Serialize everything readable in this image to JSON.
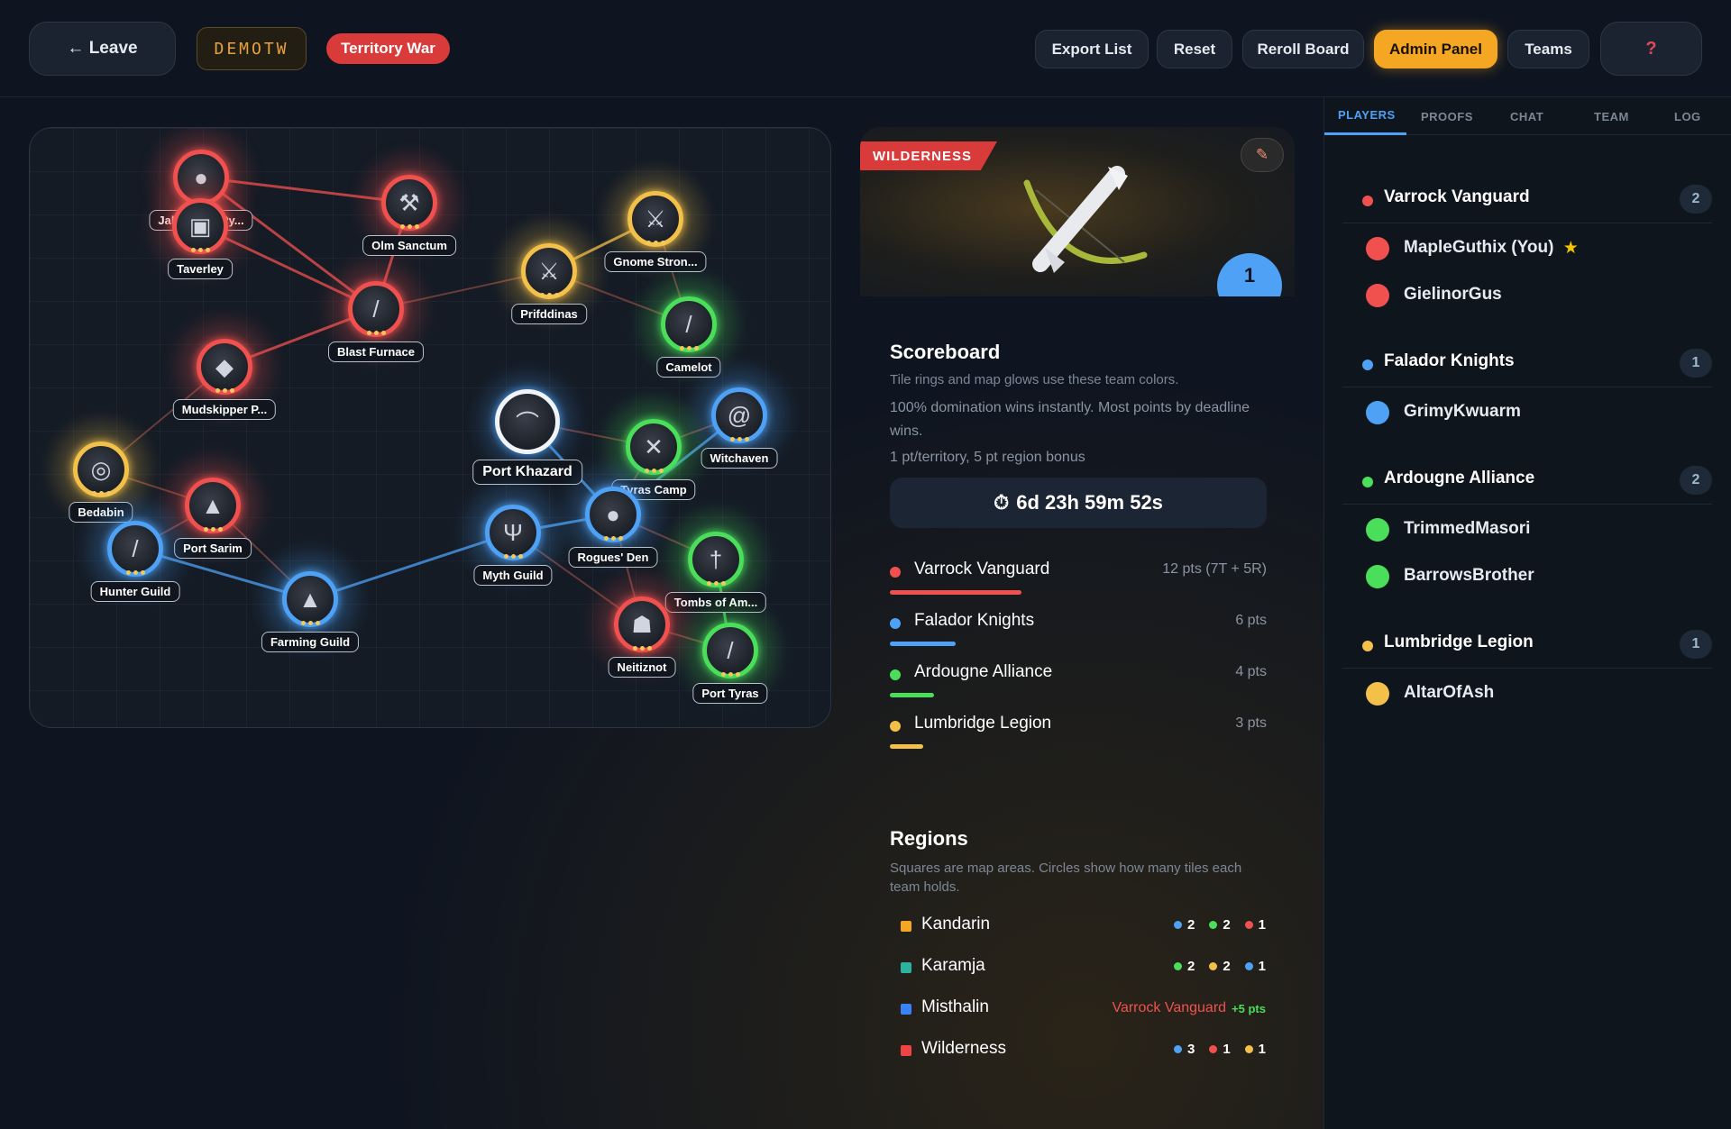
{
  "topbar": {
    "leave": "← Leave",
    "room_code": "DEMOTW",
    "mode": "Territory War",
    "buttons": {
      "export": "Export List",
      "reset": "Reset",
      "reroll": "Reroll Board",
      "admin": "Admin Panel",
      "teams": "Teams",
      "help": "?"
    }
  },
  "colors": {
    "red": "#f0514f",
    "blue": "#4ea1f4",
    "green": "#4ade5a",
    "yellow": "#f3c04a",
    "accent": "#f5a623"
  },
  "map": {
    "nodes": [
      {
        "label": "Jaldraocht Py...",
        "team": "red",
        "icon": "amulet-icon"
      },
      {
        "label": "Olm Sanctum",
        "team": "red",
        "icon": "hammer-icon"
      },
      {
        "label": "Gnome Stron...",
        "team": "yellow",
        "icon": "axe-icon"
      },
      {
        "label": "Taverley",
        "team": "red",
        "icon": "armour-icon"
      },
      {
        "label": "Prifddinas",
        "team": "yellow",
        "icon": "sword-icon"
      },
      {
        "label": "Blast Furnace",
        "team": "red",
        "icon": "staff-icon"
      },
      {
        "label": "Camelot",
        "team": "green",
        "icon": "spear-icon"
      },
      {
        "label": "Mudskipper P...",
        "team": "red",
        "icon": "crystal-icon"
      },
      {
        "label": "Port Khazard",
        "team": "blue",
        "icon": "bow-icon",
        "selected": true
      },
      {
        "label": "Witchaven",
        "team": "blue",
        "icon": "whip-icon"
      },
      {
        "label": "Tyras Camp",
        "team": "green",
        "icon": "crossbow-icon"
      },
      {
        "label": "Bedabin",
        "team": "yellow",
        "icon": "ring-icon"
      },
      {
        "label": "Port Sarim",
        "team": "red",
        "icon": "helm-icon"
      },
      {
        "label": "Rogues' Den",
        "team": "blue",
        "icon": "orb-icon"
      },
      {
        "label": "Myth Guild",
        "team": "blue",
        "icon": "claws-icon"
      },
      {
        "label": "Hunter Guild",
        "team": "blue",
        "icon": "wand-icon"
      },
      {
        "label": "Tombs of Am...",
        "team": "green",
        "icon": "dagger-icon"
      },
      {
        "label": "Farming Guild",
        "team": "blue",
        "icon": "hat-icon"
      },
      {
        "label": "Neitiznot",
        "team": "red",
        "icon": "mask-icon"
      },
      {
        "label": "Port Tyras",
        "team": "green",
        "icon": "blade-icon"
      }
    ]
  },
  "tile": {
    "region_tag": "WILDERNESS",
    "drops": "1",
    "icon": "crossbow-icon"
  },
  "scoreboard": {
    "title": "Scoreboard",
    "note": "Tile rings and map glows use these team colors.",
    "rule1": "100% domination wins instantly. Most points by deadline wins.",
    "rule2": "1 pt/territory, 5 pt region bonus",
    "timer": "6d 23h 59m 52s",
    "rows": [
      {
        "team": "Varrock Vanguard",
        "pts": "12 pts (7T + 5R)",
        "color": "#f0514f",
        "value": 12
      },
      {
        "team": "Falador Knights",
        "pts": "6 pts",
        "color": "#4ea1f4",
        "value": 6
      },
      {
        "team": "Ardougne Alliance",
        "pts": "4 pts",
        "color": "#4ade5a",
        "value": 4
      },
      {
        "team": "Lumbridge Legion",
        "pts": "3 pts",
        "color": "#f3c04a",
        "value": 3
      }
    ]
  },
  "regions": {
    "title": "Regions",
    "note": "Squares are map areas. Circles show how many tiles each team holds.",
    "rows": [
      {
        "name": "Kandarin",
        "color": "#f5a623",
        "counts": [
          [
            "#4ea1f4",
            "2"
          ],
          [
            "#4ade5a",
            "2"
          ],
          [
            "#f0514f",
            "1"
          ]
        ]
      },
      {
        "name": "Karamja",
        "color": "#2bb3a0",
        "counts": [
          [
            "#4ade5a",
            "2"
          ],
          [
            "#f3c04a",
            "2"
          ],
          [
            "#4ea1f4",
            "1"
          ]
        ]
      },
      {
        "name": "Misthalin",
        "color": "#3b82f6",
        "owner": "Varrock Vanguard",
        "bonus": "+5 pts"
      },
      {
        "name": "Wilderness",
        "color": "#ef4444",
        "counts": [
          [
            "#4ea1f4",
            "3"
          ],
          [
            "#f0514f",
            "1"
          ],
          [
            "#f3c04a",
            "1"
          ]
        ]
      }
    ]
  },
  "sidebar": {
    "tabs": [
      "PLAYERS",
      "PROOFS",
      "CHAT",
      "TEAM",
      "LOG"
    ],
    "active_tab": "PLAYERS",
    "teams": [
      {
        "name": "Varrock Vanguard",
        "count": "2",
        "color": "#f0514f",
        "players": [
          "MapleGuthix (You)",
          "GielinorGus"
        ]
      },
      {
        "name": "Falador Knights",
        "count": "1",
        "color": "#4ea1f4",
        "players": [
          "GrimyKwuarm"
        ]
      },
      {
        "name": "Ardougne Alliance",
        "count": "2",
        "color": "#4ade5a",
        "players": [
          "TrimmedMasori",
          "BarrowsBrother"
        ]
      },
      {
        "name": "Lumbridge Legion",
        "count": "1",
        "color": "#f3c04a",
        "players": [
          "AltarOfAsh"
        ]
      }
    ]
  }
}
